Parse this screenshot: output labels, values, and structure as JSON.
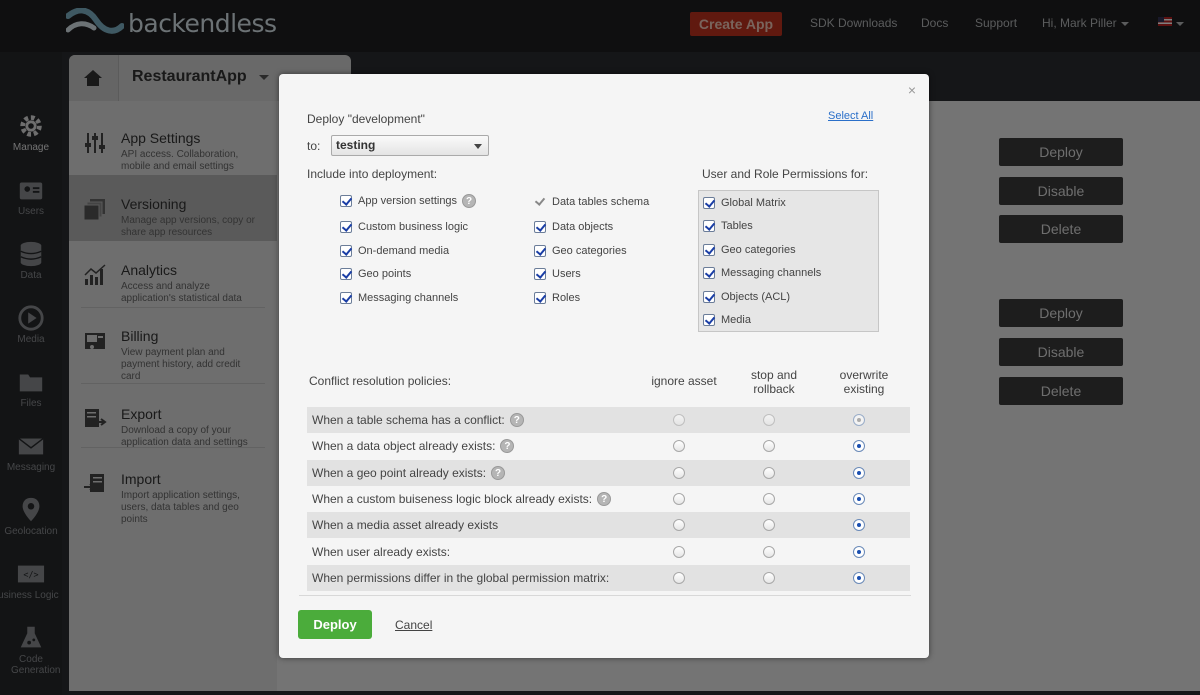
{
  "brand": {
    "logo_text": "backendless"
  },
  "topnav": {
    "create_app": "Create App",
    "sdk": "SDK Downloads",
    "docs": "Docs",
    "support": "Support",
    "user": "Hi, Mark Piller"
  },
  "iconbar": {
    "items": [
      "Manage",
      "Users",
      "Data",
      "Media",
      "Files",
      "Messaging",
      "Geolocation",
      "Business Logic",
      "Code Generation"
    ]
  },
  "app": {
    "name": "RestaurantApp"
  },
  "menu": {
    "items": [
      {
        "title": "App Settings",
        "desc": "API access. Collaboration, mobile and email settings"
      },
      {
        "title": "Versioning",
        "desc": "Manage app versions, copy or share app resources"
      },
      {
        "title": "Analytics",
        "desc": "Access and analyze application's statistical data"
      },
      {
        "title": "Billing",
        "desc": "View payment plan and payment history, add credit card"
      },
      {
        "title": "Export",
        "desc": "Download a copy of your application data and settings"
      },
      {
        "title": "Import",
        "desc": "Import application settings, users, data tables and geo points"
      }
    ]
  },
  "background_buttons": [
    "Deploy",
    "Disable",
    "Delete",
    "Deploy",
    "Disable",
    "Delete"
  ],
  "modal": {
    "close": "×",
    "title": "Deploy \"development\"",
    "select_all": "Select All",
    "to_label": "to:",
    "to_value": "testing",
    "include_label": "Include into deployment:",
    "include_col1": [
      {
        "label": "App version settings",
        "checked": true,
        "help": true
      },
      {
        "label": "Custom business logic",
        "checked": true
      },
      {
        "label": "On-demand media",
        "checked": true
      },
      {
        "label": "Geo points",
        "checked": true
      },
      {
        "label": "Messaging channels",
        "checked": true
      }
    ],
    "include_col2": [
      {
        "label": "Data tables schema",
        "checked": true,
        "disabled": true
      },
      {
        "label": "Data objects",
        "checked": true
      },
      {
        "label": "Geo categories",
        "checked": true
      },
      {
        "label": "Users",
        "checked": true
      },
      {
        "label": "Roles",
        "checked": true
      }
    ],
    "perm_label": "User and Role Permissions for:",
    "permissions": [
      {
        "label": "Global Matrix",
        "checked": true
      },
      {
        "label": "Tables",
        "checked": true
      },
      {
        "label": "Geo categories",
        "checked": true
      },
      {
        "label": "Messaging channels",
        "checked": true
      },
      {
        "label": "Objects (ACL)",
        "checked": true
      },
      {
        "label": "Media",
        "checked": true
      }
    ],
    "conflict_label": "Conflict resolution policies:",
    "policy_headers": [
      "ignore asset",
      "stop and\nrollback",
      "overwrite\nexisting"
    ],
    "policies": [
      {
        "label": "When a table schema has a conflict:",
        "help": true,
        "selected": 2,
        "disabled": true
      },
      {
        "label": "When a data object already exists:",
        "help": true,
        "selected": 2
      },
      {
        "label": "When a geo point already exists:",
        "help": true,
        "selected": 2
      },
      {
        "label": "When a custom buiseness logic block already exists:",
        "help": true,
        "selected": 2
      },
      {
        "label": "When a media asset already exists",
        "help": false,
        "selected": 2
      },
      {
        "label": "When user already exists:",
        "help": false,
        "selected": 2
      },
      {
        "label": "When permissions differ in the global permission matrix:",
        "help": false,
        "selected": 2
      }
    ],
    "deploy_button": "Deploy",
    "cancel": "Cancel"
  }
}
